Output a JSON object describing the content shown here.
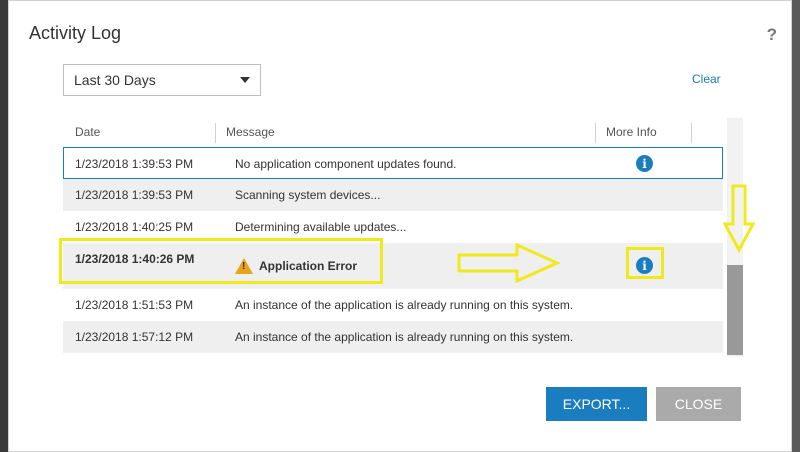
{
  "dialog": {
    "title": "Activity Log",
    "help_label": "?",
    "filter": {
      "selected": "Last 30 Days"
    },
    "clear_label": "Clear"
  },
  "table": {
    "columns": [
      "Date",
      "Message",
      "More Info"
    ],
    "rows": [
      {
        "date": "1/23/2018 1:39:53 PM",
        "message": "No application component updates found.",
        "info": true
      },
      {
        "date": "1/23/2018 1:39:53 PM",
        "message": "Scanning system devices...",
        "info": false
      },
      {
        "date": "1/23/2018 1:40:25 PM",
        "message": "Determining available updates...",
        "info": false
      },
      {
        "date": "1/23/2018 1:40:26 PM",
        "message": "Application Error",
        "info": true
      },
      {
        "date": "1/23/2018 1:51:53 PM",
        "message": "An instance of the application is already running on this system.",
        "info": false
      },
      {
        "date": "1/23/2018 1:57:12 PM",
        "message": "An instance of the application is already running on this system.",
        "info": false
      }
    ]
  },
  "buttons": {
    "export": "EXPORT...",
    "close": "CLOSE"
  },
  "icons": {
    "info": "i",
    "warning": "!"
  },
  "colors": {
    "accent": "#1a7dc0",
    "highlight": "#f0e91c",
    "warning": "#e8a317"
  }
}
